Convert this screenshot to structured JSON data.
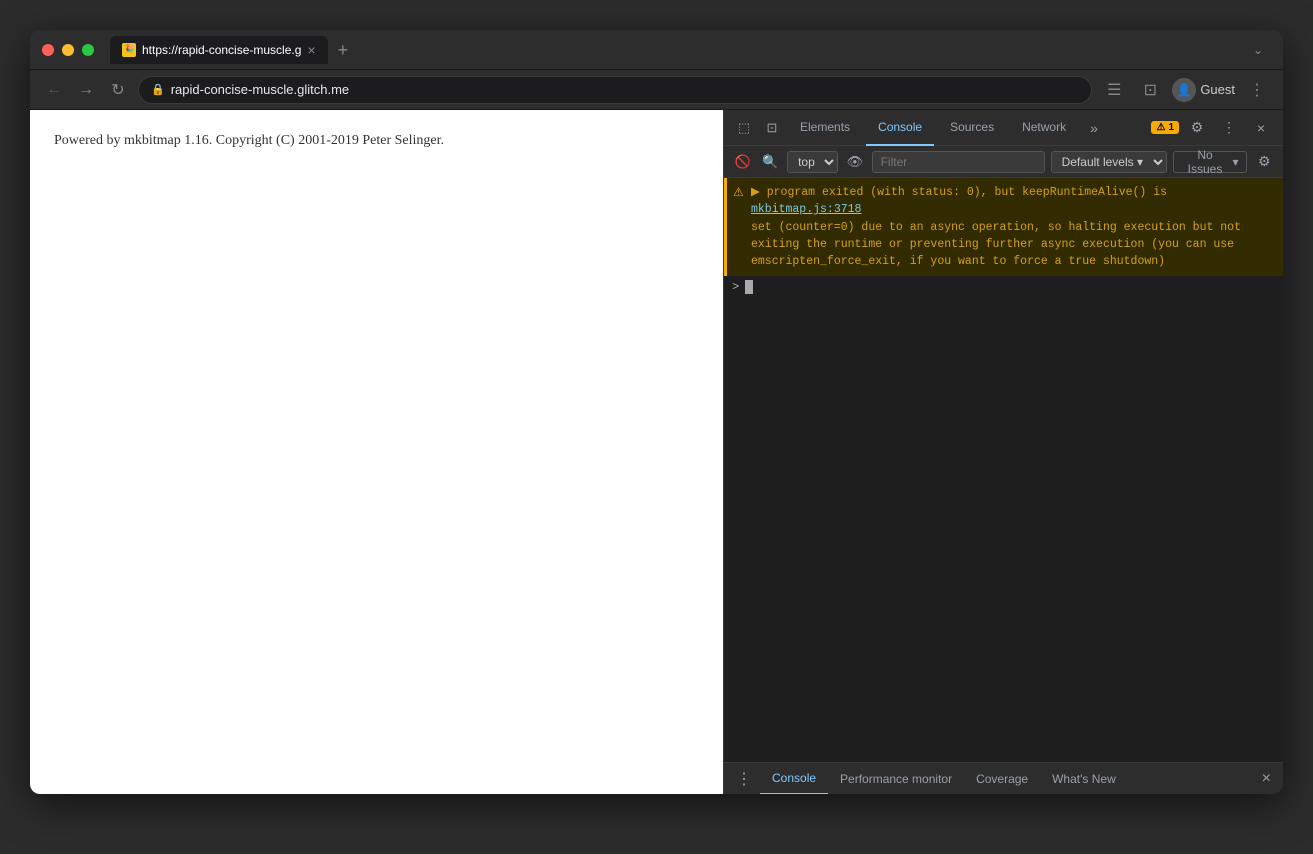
{
  "browser": {
    "traffic_lights": [
      "red",
      "yellow",
      "green"
    ],
    "tab": {
      "favicon": "🎉",
      "title": "https://rapid-concise-muscle.g",
      "close": "×"
    },
    "new_tab": "+",
    "expand_btn": "⌄",
    "address": {
      "back": "←",
      "forward": "→",
      "refresh": "↻",
      "lock": "🔒",
      "url": "rapid-concise-muscle.glitch.me"
    },
    "address_actions": {
      "sidebar": "☰",
      "tab_search": "⊡",
      "account_label": "Guest",
      "more": "⋮"
    }
  },
  "page": {
    "content": "Powered by mkbitmap 1.16. Copyright (C) 2001-2019 Peter Selinger."
  },
  "devtools": {
    "tabs": [
      {
        "id": "elements",
        "label": "Elements",
        "active": false
      },
      {
        "id": "console",
        "label": "Console",
        "active": true
      },
      {
        "id": "sources",
        "label": "Sources",
        "active": false
      },
      {
        "id": "network",
        "label": "Network",
        "active": false
      }
    ],
    "more_tabs": "»",
    "warning_badge": "⚠ 1",
    "settings_icon": "⚙",
    "more_icon": "⋮",
    "close_icon": "×",
    "inspect_icon": "⬚",
    "device_icon": "⊡",
    "toolbar": {
      "context": "top",
      "eye_icon": "👁",
      "filter_placeholder": "Filter",
      "levels": "Default levels",
      "levels_arrow": "▾",
      "no_issues": "No Issues",
      "no_issues_icon": "▾",
      "gear_icon": "⚙"
    },
    "console": {
      "warning_icon": "⚠",
      "message_line1": "▶ program exited (with status: 0), but keepRuntimeAlive() is",
      "message_link": "mkbitmap.js:3718",
      "message_line2": "set (counter=0) due to an async operation, so halting execution but not",
      "message_line3": "exiting the runtime or preventing further async execution (you can use",
      "message_line4": "emscripten_force_exit, if you want to force a true shutdown)",
      "prompt_arrow": ">",
      "prompt_arrow2": ">"
    },
    "bottom_tabs": [
      {
        "id": "console-bottom",
        "label": "Console",
        "active": true
      },
      {
        "id": "performance-monitor",
        "label": "Performance monitor",
        "active": false
      },
      {
        "id": "coverage",
        "label": "Coverage",
        "active": false
      },
      {
        "id": "whats-new",
        "label": "What's New",
        "active": false
      }
    ],
    "bottom_menu_icon": "⋮",
    "bottom_close_icon": "×"
  }
}
